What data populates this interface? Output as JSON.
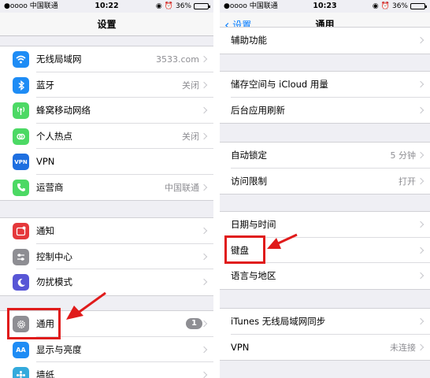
{
  "colors": {
    "accent": "#007aff",
    "annotation": "#e01b1b",
    "badge": "#8e8e93"
  },
  "left": {
    "status": {
      "carrier": "●oooo 中国联通 ",
      "time": "10:22",
      "battery": "36%",
      "battery_level": 0.36
    },
    "title": "设置",
    "groups": [
      {
        "items": [
          {
            "label": "无线局域网",
            "value": "3533.com",
            "icon": "wifi-icon",
            "icon_color": "#1e8cf5"
          },
          {
            "label": "蓝牙",
            "value": "关闭",
            "icon": "bluetooth-icon",
            "icon_color": "#1e8cf5"
          },
          {
            "label": "蜂窝移动网络",
            "value": "",
            "icon": "cellular-icon",
            "icon_color": "#4cd964"
          },
          {
            "label": "个人热点",
            "value": "关闭",
            "icon": "hotspot-icon",
            "icon_color": "#4cd964"
          },
          {
            "label": "VPN",
            "value": "",
            "icon": "vpn-icon",
            "icon_color": "#1e6fe0",
            "icon_text": "VPN"
          },
          {
            "label": "运营商",
            "value": "中国联通",
            "icon": "phone-icon",
            "icon_color": "#4cd964"
          }
        ]
      },
      {
        "items": [
          {
            "label": "通知",
            "value": "",
            "icon": "notifications-icon",
            "icon_color": "#e5383b"
          },
          {
            "label": "控制中心",
            "value": "",
            "icon": "control-center-icon",
            "icon_color": "#8e8e93"
          },
          {
            "label": "勿扰模式",
            "value": "",
            "icon": "moon-icon",
            "icon_color": "#5856d6"
          }
        ]
      },
      {
        "items": [
          {
            "label": "通用",
            "value": "",
            "badge": "1",
            "icon": "gear-icon",
            "icon_color": "#8e8e93"
          },
          {
            "label": "显示与亮度",
            "value": "",
            "icon": "display-icon",
            "icon_color": "#1e8cf5",
            "icon_text": "AA"
          },
          {
            "label": "墙纸",
            "value": "",
            "icon": "wallpaper-icon",
            "icon_color": "#34aadc"
          }
        ]
      }
    ]
  },
  "right": {
    "status": {
      "carrier": "●oooo 中国联通 ",
      "time": "10:23",
      "battery": "36%",
      "battery_level": 0.36
    },
    "title": "通用",
    "back_label": "设置",
    "groups": [
      {
        "items": [
          {
            "label": "辅助功能",
            "value": ""
          }
        ]
      },
      {
        "items": [
          {
            "label": "储存空间与 iCloud 用量",
            "value": ""
          },
          {
            "label": "后台应用刷新",
            "value": ""
          }
        ]
      },
      {
        "items": [
          {
            "label": "自动锁定",
            "value": "5 分钟"
          },
          {
            "label": "访问限制",
            "value": "打开"
          }
        ]
      },
      {
        "items": [
          {
            "label": "日期与时间",
            "value": ""
          },
          {
            "label": "键盘",
            "value": ""
          },
          {
            "label": "语言与地区",
            "value": ""
          }
        ]
      },
      {
        "items": [
          {
            "label": "iTunes 无线局域网同步",
            "value": ""
          },
          {
            "label": "VPN",
            "value": "未连接"
          }
        ]
      }
    ]
  }
}
